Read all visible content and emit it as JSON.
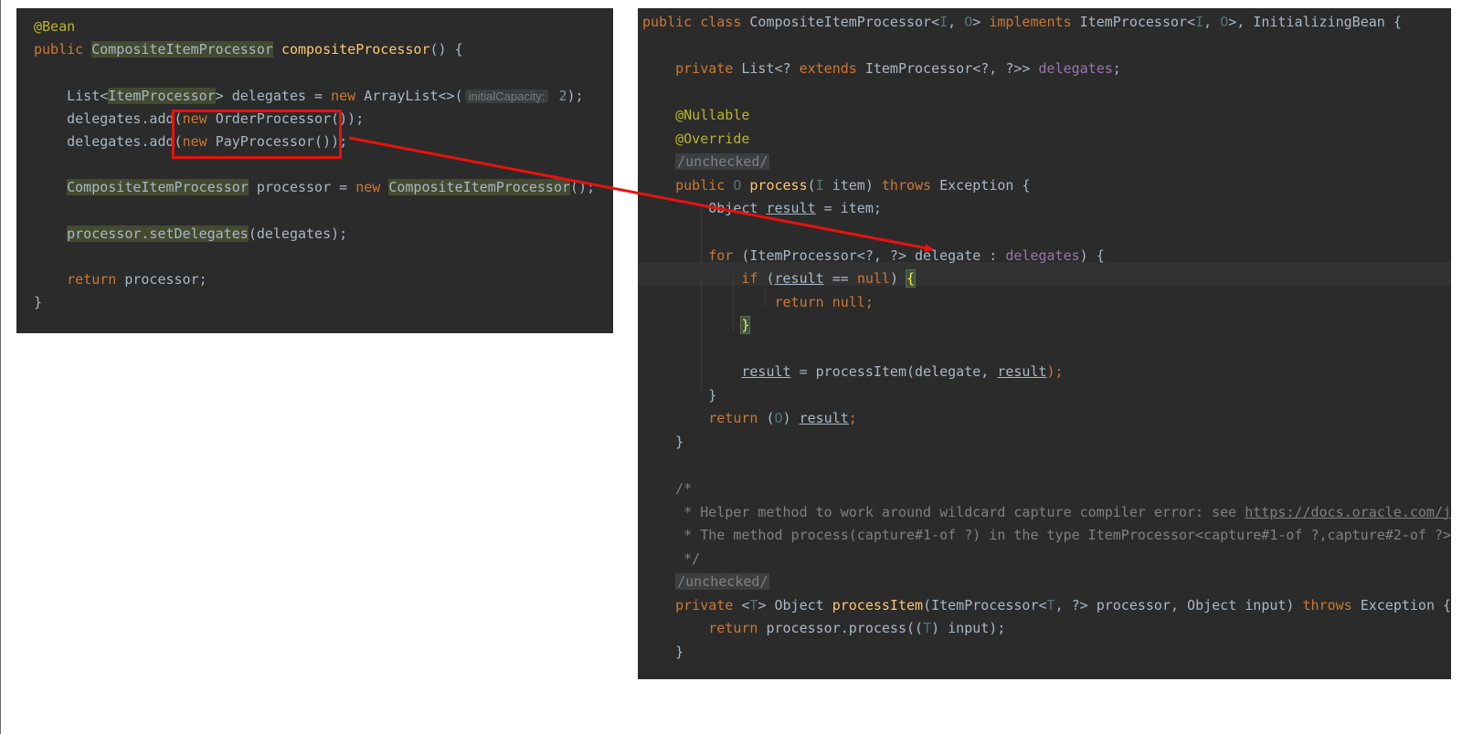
{
  "left_snippet": {
    "lines": [
      [
        {
          "t": "@Bean",
          "c": "ann"
        }
      ],
      [
        {
          "t": "public ",
          "c": "kw"
        },
        {
          "t": "CompositeItemProcessor",
          "c": "hl"
        },
        {
          "t": " "
        },
        {
          "t": "compositeProcessor",
          "c": "fn"
        },
        {
          "t": "() {"
        }
      ],
      [],
      [
        {
          "t": "    List<"
        },
        {
          "t": "ItemProcessor",
          "c": "hl"
        },
        {
          "t": "> delegates = "
        },
        {
          "t": "new ",
          "c": "kw"
        },
        {
          "t": "ArrayList<>("
        },
        {
          "t": "initialCapacity:",
          "c": "hint"
        },
        {
          "t": " "
        },
        {
          "t": "2",
          "c": "num"
        },
        {
          "t": ");"
        }
      ],
      [
        {
          "t": "    delegates.add("
        },
        {
          "t": "new ",
          "c": "kw"
        },
        {
          "t": "OrderProcessor());"
        }
      ],
      [
        {
          "t": "    delegates.add("
        },
        {
          "t": "new ",
          "c": "kw"
        },
        {
          "t": "PayProcessor());"
        }
      ],
      [],
      [
        {
          "t": "    "
        },
        {
          "t": "CompositeItemProcessor",
          "c": "hl"
        },
        {
          "t": " processor = "
        },
        {
          "t": "new ",
          "c": "kw"
        },
        {
          "t": "CompositeItemProcessor",
          "c": "hl"
        },
        {
          "t": "();"
        }
      ],
      [],
      [
        {
          "t": "    "
        },
        {
          "t": "processor.setDelegates",
          "c": "hl"
        },
        {
          "t": "(delegates);"
        }
      ],
      [],
      [
        {
          "t": "    "
        },
        {
          "t": "return ",
          "c": "kw"
        },
        {
          "t": "processor;"
        }
      ],
      [
        {
          "t": "}"
        }
      ]
    ]
  },
  "right_snippet": {
    "lines": [
      [
        {
          "t": "public class ",
          "c": "kw"
        },
        {
          "t": "CompositeItemProcessor<"
        },
        {
          "t": "I",
          "c": "tp"
        },
        {
          "t": ", "
        },
        {
          "t": "O",
          "c": "tp"
        },
        {
          "t": "> "
        },
        {
          "t": "implements ",
          "c": "kw"
        },
        {
          "t": "ItemProcessor<"
        },
        {
          "t": "I",
          "c": "tp"
        },
        {
          "t": ", "
        },
        {
          "t": "O",
          "c": "tp"
        },
        {
          "t": ">, InitializingBean {"
        }
      ],
      [],
      [
        {
          "t": "    "
        },
        {
          "t": "private ",
          "c": "kw"
        },
        {
          "t": "List<? "
        },
        {
          "t": "extends ",
          "c": "kw"
        },
        {
          "t": "ItemProcessor<?, ?>> "
        },
        {
          "t": "delegates",
          "c": "fld"
        },
        {
          "t": ";"
        }
      ],
      [],
      [
        {
          "t": "    "
        },
        {
          "t": "@Nullable",
          "c": "ann"
        }
      ],
      [
        {
          "t": "    "
        },
        {
          "t": "@Override",
          "c": "ann"
        }
      ],
      [
        {
          "t": "    "
        },
        {
          "t": "/unchecked/",
          "c": "unchecked"
        }
      ],
      [
        {
          "t": "    "
        },
        {
          "t": "public ",
          "c": "kw"
        },
        {
          "t": "O ",
          "c": "tp"
        },
        {
          "t": "process",
          "c": "fn"
        },
        {
          "t": "("
        },
        {
          "t": "I ",
          "c": "tp"
        },
        {
          "t": "item) "
        },
        {
          "t": "throws ",
          "c": "kw"
        },
        {
          "t": "Exception {"
        }
      ],
      [
        {
          "t": "        Object "
        },
        {
          "t": "result",
          "c": "ul"
        },
        {
          "t": " = item;"
        }
      ],
      [],
      [
        {
          "t": "        "
        },
        {
          "t": "for ",
          "c": "kw"
        },
        {
          "t": "(ItemProcessor<?, ?> delegate : "
        },
        {
          "t": "delegates",
          "c": "fld"
        },
        {
          "t": ") {"
        }
      ],
      [
        {
          "t": "            "
        },
        {
          "t": "if ",
          "c": "kw"
        },
        {
          "t": "("
        },
        {
          "t": "result",
          "c": "ul"
        },
        {
          "t": " == "
        },
        {
          "t": "null",
          "c": "kw"
        },
        {
          "t": ") "
        },
        {
          "t": "{",
          "c": "brace-hl"
        }
      ],
      [
        {
          "t": "                "
        },
        {
          "t": "return null",
          "c": "kw"
        },
        {
          "t": ";",
          "c": "kw"
        }
      ],
      [
        {
          "t": "            "
        },
        {
          "t": "}",
          "c": "brace-hl"
        }
      ],
      [],
      [
        {
          "t": "            "
        },
        {
          "t": "result",
          "c": "ul"
        },
        {
          "t": " = processItem(delegate, "
        },
        {
          "t": "result",
          "c": "ul"
        },
        {
          "t": ");",
          "c": "kw"
        }
      ],
      [
        {
          "t": "        }"
        }
      ],
      [
        {
          "t": "        "
        },
        {
          "t": "return ",
          "c": "kw"
        },
        {
          "t": "("
        },
        {
          "t": "O",
          "c": "tp"
        },
        {
          "t": ") "
        },
        {
          "t": "result",
          "c": "ul"
        },
        {
          "t": ";",
          "c": "kw"
        }
      ],
      [
        {
          "t": "    }"
        }
      ],
      [],
      [
        {
          "t": "    /*",
          "c": "cm"
        }
      ],
      [
        {
          "t": "     * Helper method to work around wildcard capture compiler error: see ",
          "c": "cm"
        },
        {
          "t": "https://docs.oracle.com/ja",
          "c": "lnk"
        }
      ],
      [
        {
          "t": "     * The method process(capture#1-of ?) in the type ItemProcessor<capture#1-of ?,capture#2-of ?>",
          "c": "cm"
        }
      ],
      [
        {
          "t": "     */",
          "c": "cm"
        }
      ],
      [
        {
          "t": "    "
        },
        {
          "t": "/unchecked/",
          "c": "unchecked"
        }
      ],
      [
        {
          "t": "    "
        },
        {
          "t": "private ",
          "c": "kw"
        },
        {
          "t": "<"
        },
        {
          "t": "T",
          "c": "tp"
        },
        {
          "t": "> Object "
        },
        {
          "t": "processItem",
          "c": "fn"
        },
        {
          "t": "(ItemProcessor<"
        },
        {
          "t": "T",
          "c": "tp"
        },
        {
          "t": ", ?> processor, Object input) "
        },
        {
          "t": "throws ",
          "c": "kw"
        },
        {
          "t": "Exception {"
        }
      ],
      [
        {
          "t": "        "
        },
        {
          "t": "return ",
          "c": "kw"
        },
        {
          "t": "processor.process(("
        },
        {
          "t": "T",
          "c": "tp"
        },
        {
          "t": ") input);"
        }
      ],
      [
        {
          "t": "    }"
        }
      ]
    ]
  },
  "annotation": {
    "color": "#e8120c",
    "highlighted_code": "new OrderProcessor()); new PayProcessor());",
    "arrow_target": "delegate"
  }
}
